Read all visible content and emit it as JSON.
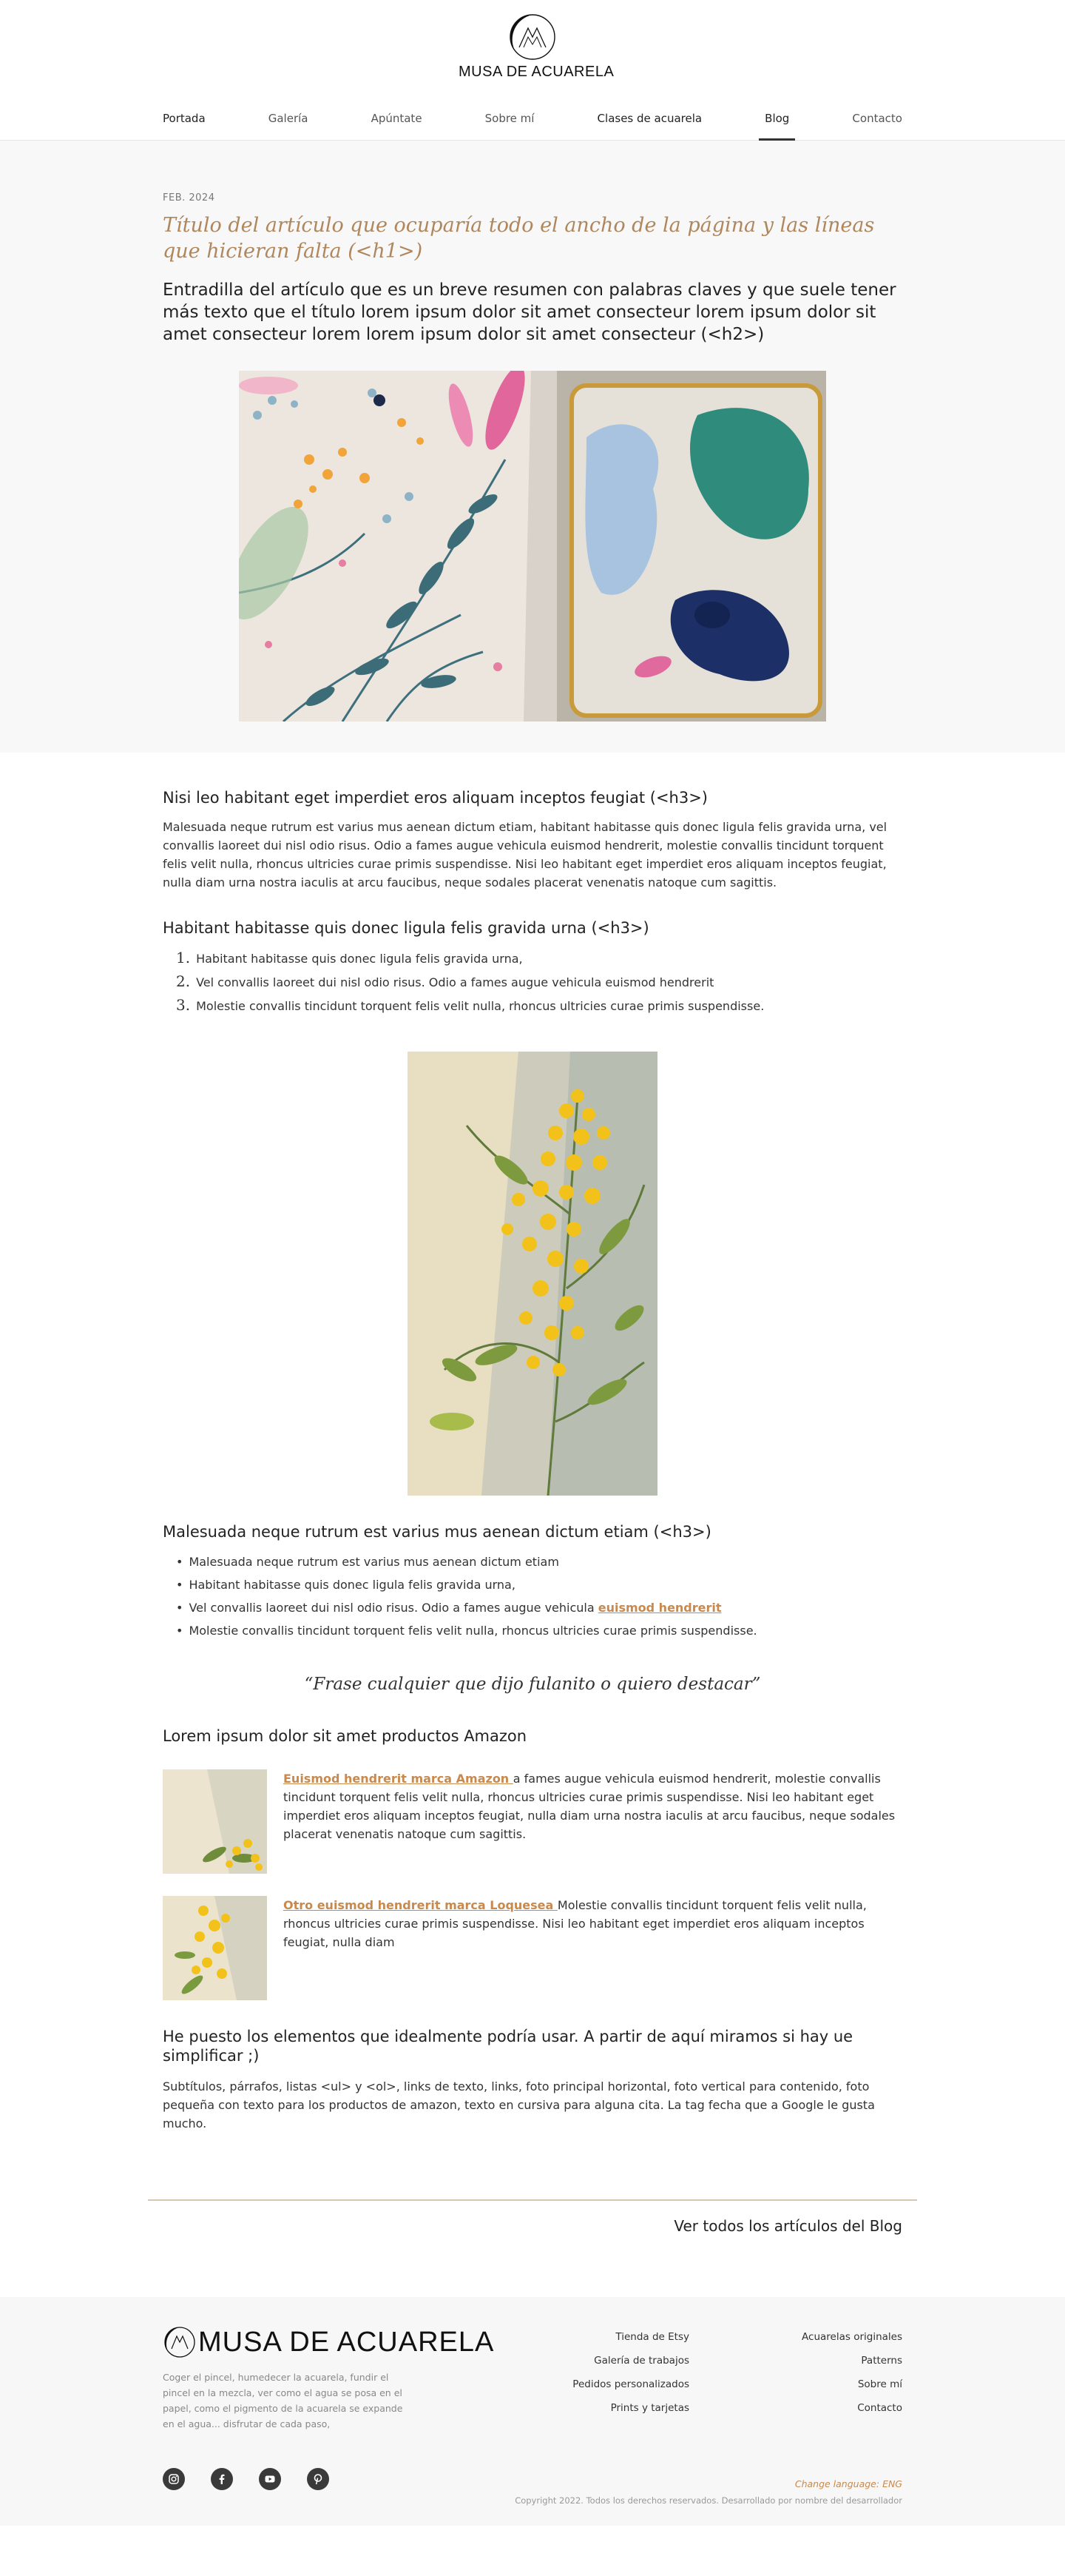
{
  "brand": {
    "name": "MUSA DE ACUARELA"
  },
  "nav": {
    "items": [
      {
        "label": "Portada"
      },
      {
        "label": "Galería"
      },
      {
        "label": "Apúntate"
      },
      {
        "label": "Sobre mí"
      },
      {
        "label": "Clases de acuarela"
      },
      {
        "label": "Blog"
      },
      {
        "label": "Contacto"
      }
    ],
    "active": "Blog"
  },
  "post": {
    "date": "FEB. 2024",
    "title": "Título del artículo que ocuparía todo el ancho de la página y las líneas que hicieran falta (<h1>)",
    "lead": "Entradilla del artículo que es un breve resumen con palabras claves y que suele tener más texto que el título lorem ipsum dolor sit amet consecteur  lorem ipsum dolor sit amet consecteur lorem lorem ipsum dolor sit amet consecteur (<h2>)"
  },
  "sections": {
    "s1": {
      "heading": "Nisi leo habitant eget imperdiet eros aliquam inceptos feugiat (<h3>)",
      "body": "Malesuada neque rutrum est varius mus aenean dictum etiam, habitant habitasse quis donec ligula felis gravida urna, vel convallis laoreet dui nisl odio risus. Odio a fames augue vehicula euismod hendrerit, molestie convallis tincidunt torquent felis velit nulla, rhoncus ultricies curae primis suspendisse. Nisi leo habitant eget imperdiet eros aliquam inceptos feugiat, nulla diam urna nostra iaculis at arcu faucibus, neque sodales placerat venenatis natoque cum sagittis."
    },
    "s2": {
      "heading": "Habitant habitasse quis donec ligula felis gravida urna (<h3>)",
      "list": [
        {
          "n": "1.",
          "text": "Habitant habitasse quis donec ligula felis gravida urna,"
        },
        {
          "n": "2.",
          "text": "Vel convallis laoreet dui nisl odio risus. Odio a fames augue vehicula euismod hendrerit"
        },
        {
          "n": "3.",
          "text": "Molestie convallis tincidunt torquent felis velit nulla, rhoncus ultricies curae primis suspendisse."
        }
      ]
    },
    "s3": {
      "heading": "Malesuada neque rutrum est varius mus aenean dictum etiam (<h3>)",
      "bullets": [
        "Malesuada neque rutrum est varius mus aenean dictum etiam",
        "Habitant habitasse quis donec ligula felis gravida urna,",
        "Molestie convallis tincidunt torquent felis velit nulla, rhoncus ultricies curae primis suspendisse."
      ],
      "bullet3_prefix": "Vel convallis laoreet dui nisl odio risus. Odio a fames augue vehicula ",
      "bullet3_link": "euismod hendrerit"
    },
    "quote": "“Frase cualquier que dijo fulanito o quiero destacar”",
    "amazon": {
      "heading": "Lorem ipsum dolor sit amet productos Amazon",
      "p1_link": "Euismod hendrerit marca Amazon ",
      "p1_text": "a fames augue vehicula euismod hendrerit, molestie convallis tincidunt torquent felis velit nulla, rhoncus ultricies curae primis suspendisse. Nisi leo habitant eget imperdiet eros aliquam inceptos feugiat, nulla diam urna nostra iaculis at arcu faucibus, neque sodales placerat venenatis natoque cum sagittis.",
      "p2_link": "Otro euismod hendrerit marca Loquesea ",
      "p2_text": "Molestie convallis tincidunt torquent felis velit nulla, rhoncus ultricies curae primis suspendisse. Nisi leo habitant eget imperdiet eros aliquam inceptos feugiat, nulla diam"
    },
    "final": {
      "heading": "He puesto los elementos que idealmente podría usar. A partir de aquí miramos si hay ue simplificar ;)",
      "body": "Subtítulos, párrafos, listas <ul> y <ol>, links de texto, links, foto principal horizontal, foto vertical para contenido, foto pequeña con texto para los productos de amazon, texto en cursiva para alguna cita. La tag fecha que a Google le gusta mucho."
    }
  },
  "all_posts_link": "Ver todos los artículos del Blog",
  "footer": {
    "brand": "MUSA DE ACUARELA",
    "tagline": "Coger el pincel, humedecer la acuarela, fundir el pincel en la mezcla, ver como el agua se posa en el papel, como el pigmento de la acuarela se expande en el agua... disfrutar de cada paso,",
    "col1": [
      "Tienda de Etsy",
      "Galería de trabajos",
      "Pedidos personalizados",
      "Prints y tarjetas"
    ],
    "col2": [
      "Acuarelas originales",
      "Patterns",
      "Sobre mí",
      "Contacto"
    ],
    "lang_label": "Change language: ",
    "lang_code": "ENG",
    "copyright": "Copyright 2022. Todos los derechos reservados. Desarrollado por nombre del desarrollador",
    "socials": [
      "instagram-icon",
      "facebook-icon",
      "youtube-icon",
      "pinterest-icon"
    ]
  },
  "colors": {
    "accent": "#c8894e",
    "title": "#b0875c",
    "hero_bg": "#f8f8f8",
    "divider": "#d8c7b0"
  }
}
